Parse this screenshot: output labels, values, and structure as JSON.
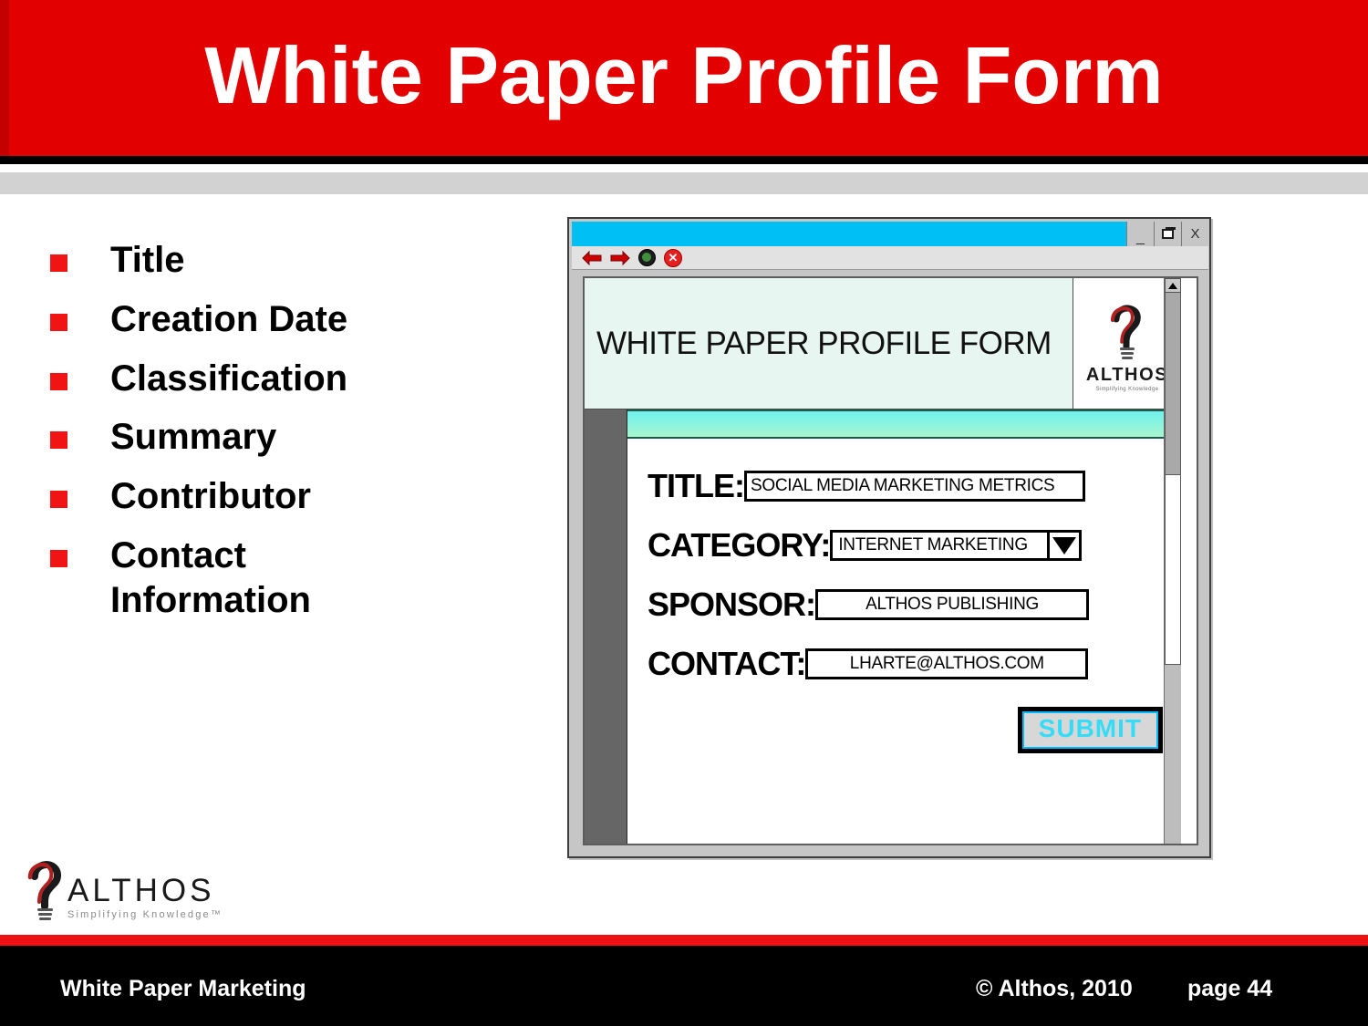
{
  "slide": {
    "title": "White Paper Profile Form"
  },
  "bullets": [
    {
      "label": "Title"
    },
    {
      "label": "Creation Date"
    },
    {
      "label": "Classification"
    },
    {
      "label": "Summary"
    },
    {
      "label": "Contributor"
    },
    {
      "label": "Contact Information"
    }
  ],
  "browser": {
    "titlebar": {
      "minimize_label": "_",
      "maximize_label": "maximize-icon",
      "close_label": "X"
    },
    "toolbar": {
      "back_icon": "back-arrow-icon",
      "forward_icon": "forward-arrow-icon",
      "home_icon": "globe-icon",
      "stop_icon": "stop-icon"
    },
    "scrollbar": {
      "up_arrow": "scroll-up-arrow-icon"
    }
  },
  "form": {
    "header_title": "WHITE PAPER PROFILE FORM",
    "logo": {
      "wordmark": "ALTHOS",
      "tagline": "Simplifying Knowledge"
    },
    "fields": [
      {
        "label": "TITLE:",
        "value": "SOCIAL MEDIA MARKETING METRICS",
        "type": "text"
      },
      {
        "label": "CATEGORY:",
        "value": "INTERNET MARKETING",
        "type": "select"
      },
      {
        "label": "SPONSOR:",
        "value": "ALTHOS PUBLISHING",
        "type": "text"
      },
      {
        "label": "CONTACT:",
        "value": "LHARTE@ALTHOS.COM",
        "type": "text"
      }
    ],
    "submit_label": "SUBMIT"
  },
  "corner_logo": {
    "wordmark": "ALTHOS",
    "tagline": "Simplifying Knowledge™"
  },
  "footer": {
    "left": "White Paper Marketing",
    "copyright": "© Althos,  2010",
    "page": "page 44"
  },
  "colors": {
    "banner_red": "#e30000",
    "bullet_red": "#f01414",
    "titlebar_cyan": "#00bff3",
    "submit_cyan": "#35dcf7",
    "sidebar_gray": "#666666"
  }
}
